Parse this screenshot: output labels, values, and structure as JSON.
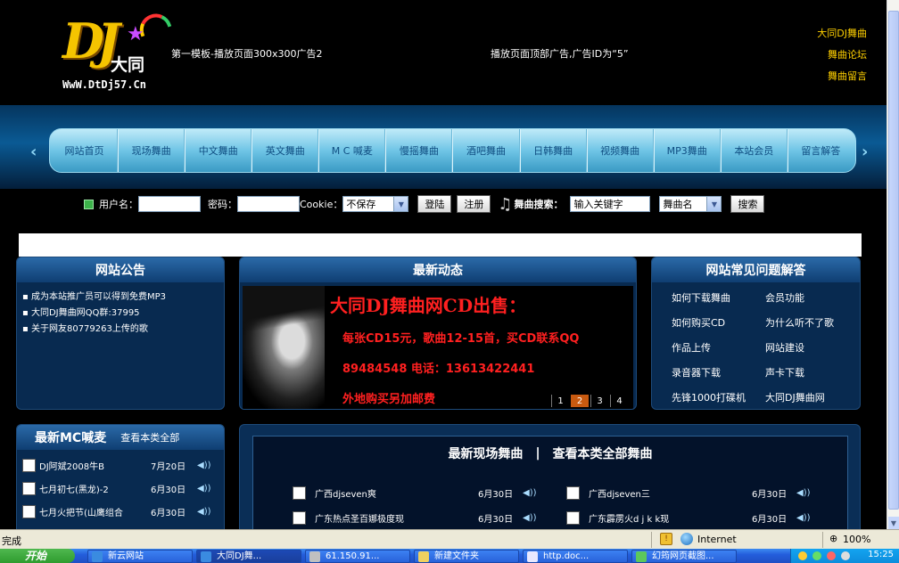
{
  "header": {
    "logo_text": "DJ",
    "logo_name": "大同",
    "logo_url": "WwW.DtDj57.Cn",
    "ad_left": "第一模板-播放页面300x300广告2",
    "ad_top": "播放页面顶部广告,广告ID为“5”",
    "links": [
      "大同DJ舞曲",
      "舞曲论坛",
      "舞曲留言"
    ]
  },
  "nav": {
    "items": [
      "网站首页",
      "现场舞曲",
      "中文舞曲",
      "英文舞曲",
      "M C 喊麦",
      "慢摇舞曲",
      "酒吧舞曲",
      "日韩舞曲",
      "视频舞曲",
      "MP3舞曲",
      "本站会员",
      "留言解答"
    ],
    "prev": "‹",
    "next": "›"
  },
  "login": {
    "username_label": "用户名：",
    "password_label": "密码：",
    "cookie_label": "Cookie：",
    "cookie_value": "不保存",
    "login_button": "登陆",
    "register_button": "注册",
    "search_label": "舞曲搜索：",
    "search_value": "输入关键字",
    "search_type": "舞曲名",
    "search_button": "搜索"
  },
  "notice": {
    "title": "网站公告",
    "items": [
      "成为本站推广员可以得到免费MP3",
      "大同DJ舞曲网QQ群:37995",
      "关于网友80779263上传的歌"
    ]
  },
  "news": {
    "title": "最新动态",
    "banner_title": "大同DJ舞曲网CD出售：",
    "lines": [
      "每张CD15元，歌曲12-15首，买CD联系QQ",
      "89484548  电话：13613422441",
      "外地购买另加邮费"
    ],
    "pages": [
      "1",
      "2",
      "3",
      "4"
    ],
    "active_page": "2"
  },
  "faq": {
    "title": "网站常见问题解答",
    "links": [
      "如何下载舞曲",
      "会员功能",
      "如何购买CD",
      "为什么听不了歌",
      "作品上传",
      "网站建设",
      "录音器下载",
      "声卡下载",
      "先锋1000打碟机",
      "大同DJ舞曲网"
    ]
  },
  "mc": {
    "title_prefix": "最新",
    "title_bold": "MC",
    "title_suffix": "喊麦",
    "more": "查看本类全部",
    "rows": [
      {
        "name": "DJ阿斌2008牛B",
        "date": "7月20日"
      },
      {
        "name": "七月初七(黑龙)-2",
        "date": "6月30日"
      },
      {
        "name": "七月火把节(山鹰组合",
        "date": "6月30日"
      }
    ]
  },
  "live": {
    "title": "最新现场舞曲",
    "separator": "|",
    "more": "查看本类全部舞曲",
    "rows_left": [
      {
        "name": "广西djseven爽",
        "date": "6月30日"
      },
      {
        "name": "广东热点圣百娜极度现",
        "date": "6月30日"
      }
    ],
    "rows_right": [
      {
        "name": "广西djseven三",
        "date": "6月30日"
      },
      {
        "name": "广东霹雳火d j k k现",
        "date": "6月30日"
      }
    ]
  },
  "statusbar": {
    "text": "完成",
    "zone": "Internet",
    "zoom": "100%"
  },
  "taskbar": {
    "start": "开始",
    "tasks": [
      "新云网站",
      "大同DJ舞...",
      "61.150.91...",
      "新建文件夹",
      "http.doc...",
      "幻筠网页截图..."
    ],
    "clock": "15:25"
  },
  "colors": {
    "accent_gold": "#ffd000",
    "banner_red": "#ff2020",
    "nav_text": "#0f4c80",
    "panel_bg": "#082a50"
  }
}
